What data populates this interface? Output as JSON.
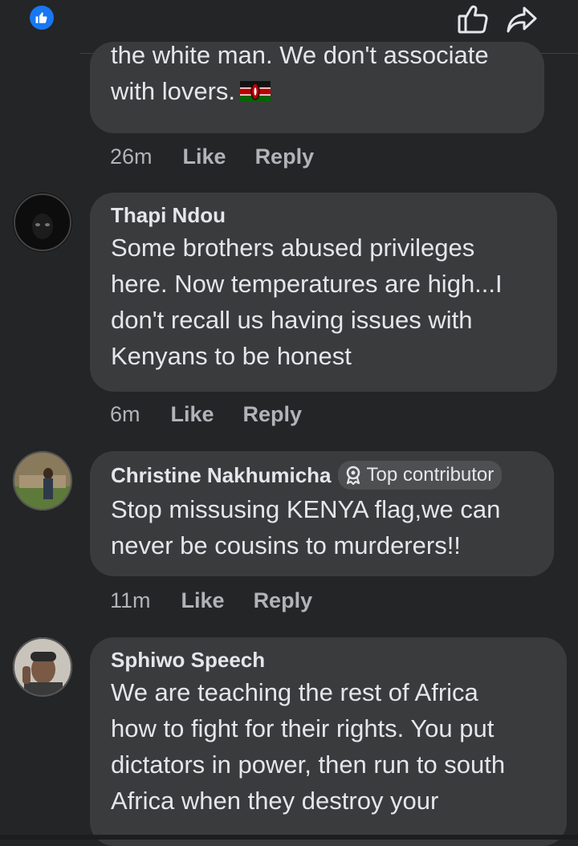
{
  "top_actions": {
    "like_icon": "thumbs-up-outline-icon",
    "share_icon": "share-arrow-icon",
    "reaction_icon": "like-reaction-icon"
  },
  "comments": [
    {
      "text_partial_line": "the white man. We don't associate",
      "text_last": "with lovers.",
      "emoji": "kenya-flag",
      "time": "26m",
      "like": "Like",
      "reply": "Reply"
    },
    {
      "author": "Thapi Ndou",
      "lines": [
        "Some brothers abused privileges",
        "here. Now temperatures are high...I",
        "don't recall us having issues with",
        "Kenyans to be honest"
      ],
      "time": "6m",
      "like": "Like",
      "reply": "Reply"
    },
    {
      "author": "Christine Nakhumicha",
      "badge": "Top contributor",
      "badge_icon": "top-contributor-icon",
      "lines": [
        "Stop missusing KENYA flag,we can",
        "never be cousins to murderers!!"
      ],
      "time": "11m",
      "like": "Like",
      "reply": "Reply"
    },
    {
      "author": "Sphiwo Speech",
      "lines": [
        "We are teaching the rest of Africa",
        "how to fight for their rights. You put",
        "dictators in power, then run to south",
        "Africa when they destroy your"
      ]
    }
  ],
  "colors": {
    "background": "#242526",
    "bubble": "#3a3b3c",
    "text": "#e4e6eb",
    "secondary": "#b0b3b8",
    "accent": "#1877f2"
  }
}
